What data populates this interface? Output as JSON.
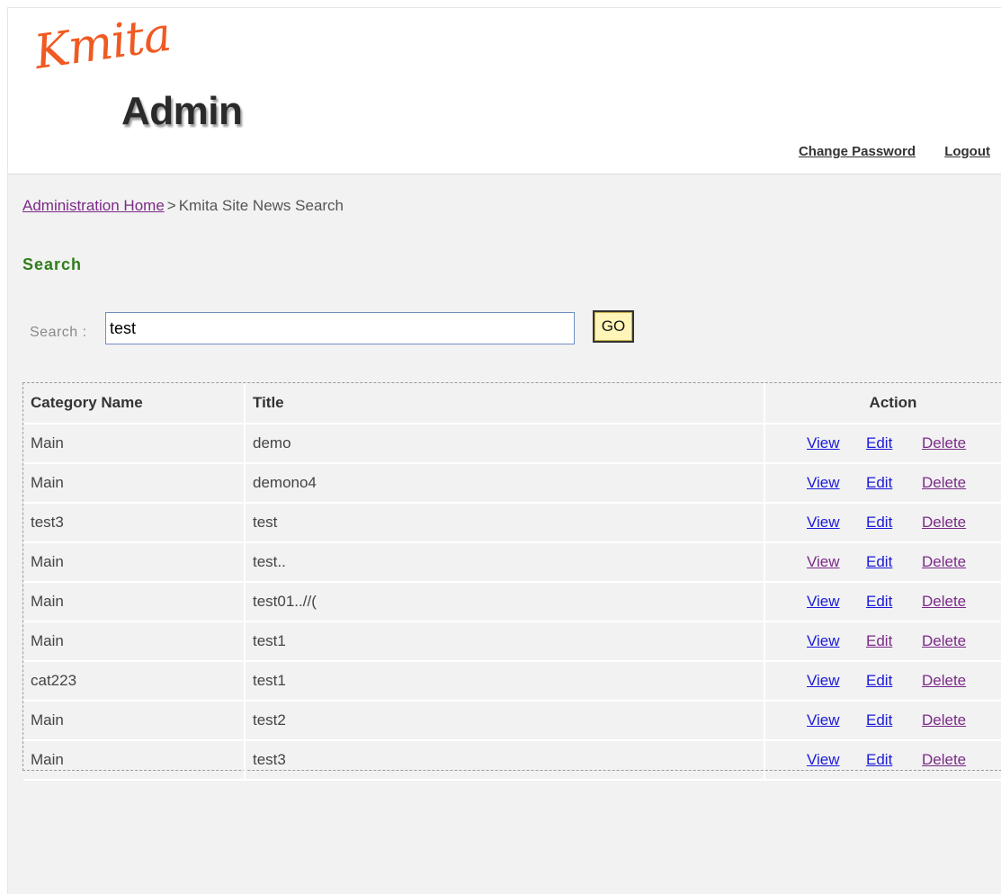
{
  "header": {
    "logo_script": "Kmita",
    "logo_word": "Admin",
    "change_password_label": "Change Password",
    "logout_label": "Logout"
  },
  "breadcrumb": {
    "home_label": "Administration Home",
    "separator": ">",
    "current_label": "Kmita Site News Search"
  },
  "section_title": "Search",
  "search": {
    "label": "Search :",
    "value": "test",
    "go_label": "GO"
  },
  "table": {
    "columns": [
      "Category Name",
      "Title",
      "Action"
    ],
    "action_labels": {
      "view": "View",
      "edit": "Edit",
      "delete": "Delete"
    },
    "rows": [
      {
        "category": "Main",
        "title": "demo",
        "view_visited": false,
        "edit_visited": false,
        "delete_visited": true
      },
      {
        "category": "Main",
        "title": "demono4",
        "view_visited": false,
        "edit_visited": false,
        "delete_visited": true
      },
      {
        "category": "test3",
        "title": "test",
        "view_visited": false,
        "edit_visited": false,
        "delete_visited": true
      },
      {
        "category": "Main",
        "title": "test..",
        "view_visited": true,
        "edit_visited": false,
        "delete_visited": true
      },
      {
        "category": "Main",
        "title": "test01..//(",
        "view_visited": false,
        "edit_visited": false,
        "delete_visited": true
      },
      {
        "category": "Main",
        "title": "test1",
        "view_visited": false,
        "edit_visited": true,
        "delete_visited": true
      },
      {
        "category": "cat223",
        "title": "test1",
        "view_visited": false,
        "edit_visited": false,
        "delete_visited": true
      },
      {
        "category": "Main",
        "title": "test2",
        "view_visited": false,
        "edit_visited": false,
        "delete_visited": true
      },
      {
        "category": "Main",
        "title": "test3",
        "view_visited": false,
        "edit_visited": false,
        "delete_visited": true
      }
    ]
  },
  "colors": {
    "link_unvisited": "#1a1ad9",
    "link_visited": "#7b2a87",
    "section_title": "#2e7d1a",
    "logo_script": "#f05a22"
  }
}
